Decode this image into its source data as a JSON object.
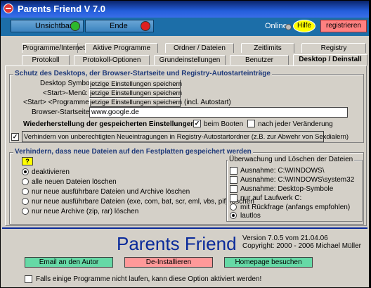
{
  "window": {
    "title": "Parents Friend V 7.0"
  },
  "toolbar": {
    "unsichtbar": "Unsichtbar",
    "ende": "Ende",
    "online": "Online",
    "hilfe": "Hilfe",
    "registrieren": "registrieren"
  },
  "tabs": {
    "row1": [
      "Programme/Internet",
      "Aktive Programme",
      "Ordner / Dateien",
      "Zeitlimits",
      "Registry"
    ],
    "row2": [
      "Protokoll",
      "Protokoll-Optionen",
      "Grundeinstellungen",
      "Benutzer",
      "Desktop / Deinstall"
    ],
    "active": "Desktop / Deinstall"
  },
  "schutz": {
    "title": "Schutz des Desktops, der Browser-Startseite und Registry-Autostarteinträge",
    "desktop_label": "Desktop Symbole:",
    "start_label": "<Start>-Menü:",
    "programme_label": "<Start> <Programme>:",
    "save_button": "jetzige Einstellungen speichern",
    "incl_note": "(incl. Autostart)",
    "browser_label": "Browser-Startseite:",
    "browser_value": "www.google.de",
    "restore_label": "Wiederherstellung der gespeicherten Einstellungen:",
    "beim_booten": "beim Booten",
    "nach_jeder": "nach jeder Veränderung",
    "verhindern_label": "Verhindern von unberechtigten Neueintragungen in Registry-Autostartordner (z.B. zur Abwehr von Sexdialern)"
  },
  "dateien": {
    "title": "Verhindern, dass neue Dateien auf den Festplatten gespeichert werden",
    "help_button": "?",
    "options": [
      "deaktivieren",
      "alle neuen Dateien löschen",
      "nur neue ausführbare Dateien und Archive löschen",
      "nur neue ausführbare Dateien (exe, com, bat, scr, eml, vbs, pif) löschen",
      "nur neue Archive (zip, rar) löschen"
    ],
    "selected_option": "deaktivieren"
  },
  "ueberwachung": {
    "title": "Überwachung und Löschen der Dateien",
    "options": [
      "Ausnahme: C:\\WINDOWS\\",
      "Ausnahme: C:\\WINDOWS\\system32",
      "Ausnahme: Desktop-Symbole",
      "nur auf Laufwerk C:",
      "mit Rückfrage (anfangs empfohlen)",
      "lautlos"
    ],
    "selected": "lautlos"
  },
  "footer": {
    "brand": "Parents Friend",
    "version": "Version 7.0.5 vom 21.04.06",
    "copyright": "Copyright: 2000 - 2006 Michael Müller",
    "email_button": "Email an den Autor",
    "deinstall_button": "De-Installieren",
    "homepage_button": "Homepage besuchen",
    "fallback_label": "Falls einige Programme nicht laufen, kann diese Option aktiviert werden!"
  },
  "colors": {
    "title_bar": "#245edb",
    "toolbar": "#1c6ea8",
    "green_dot": "#2db82d",
    "red_dot": "#e02020",
    "hilfe": "#ffff00",
    "registrieren": "#ff8080",
    "email_button": "#66d9a6",
    "deinstall_button": "#ff9999",
    "homepage_button": "#66d9a6",
    "brand": "#0a2a9a"
  },
  "icons": {
    "title": "stop-sign-icon",
    "unsichtbar": "green-circle-icon",
    "ende": "red-circle-icon",
    "online": "status-dot-icon"
  }
}
